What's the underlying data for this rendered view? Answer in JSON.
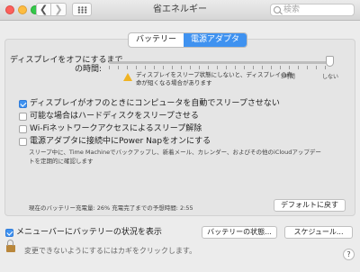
{
  "window": {
    "title": "省エネルギー",
    "back_glyph": "❮",
    "forward_glyph": "❯",
    "search_placeholder": "検索"
  },
  "tabs": [
    {
      "label": "バッテリー",
      "selected": false
    },
    {
      "label": "電源アダプタ",
      "selected": true
    }
  ],
  "display_sleep": {
    "label_line1": "ディスプレイをオフにするまで",
    "label_line2": "の時間:",
    "warning_text": "ディスプレイをスリープ状態にしないと、ディスプレイの寿命が短くなる場合があります",
    "tick_3h": "3時間",
    "tick_never": "しない",
    "value": "しない"
  },
  "options": [
    {
      "label": "ディスプレイがオフのときにコンピュータを自動でスリープさせない",
      "checked": true
    },
    {
      "label": "可能な場合はハードディスクをスリープさせる",
      "checked": false
    },
    {
      "label": "Wi-Fiネットワークアクセスによるスリープ解除",
      "checked": false
    },
    {
      "label": "電源アダプタに接続中にPower Napをオンにする",
      "checked": false
    }
  ],
  "power_nap_description": "スリープ中に、Time Machineでバックアップし、新着メール、カレンダー、およびその他のiCloudアップデートを定期的に確認します",
  "battery_status": "現在のバッテリー充電量: 26% 充電完了までの予想時間: 2:55",
  "buttons": {
    "defaults": "デフォルトに戻す",
    "battery_status": "バッテリーの状態...",
    "schedule": "スケジュール..."
  },
  "menubar_option": {
    "label": "メニューバーにバッテリーの状況を表示",
    "checked": true
  },
  "lock_text": "変更できないようにするにはカギをクリックします。",
  "help_glyph": "?",
  "colors": {
    "accent": "#3f92f0",
    "warning": "#f0b322"
  }
}
